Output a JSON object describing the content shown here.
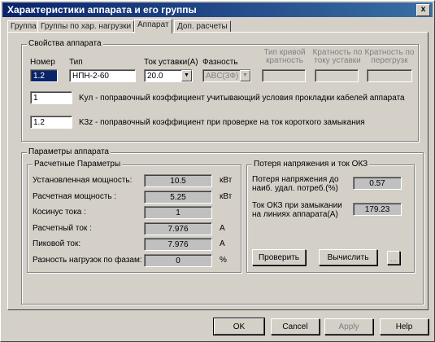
{
  "window": {
    "title": "Характеристики аппарата и его группы",
    "close_label": "x"
  },
  "tabs": [
    "Группа",
    "Группы по хар. нагрузки",
    "Аппарат",
    "Доп. расчеты"
  ],
  "device_props": {
    "legend": "Свойства аппарата",
    "number_label": "Номер",
    "number_value": "1.2",
    "type_label": "Тип",
    "type_value": "НПН-2-60",
    "current_label": "Ток уставки(А)",
    "current_value": "20.0",
    "phase_label": "Фазность",
    "phase_value": "ABC(3Ф)",
    "type_mult_label": "Тип кривой кратность",
    "mult_current_label": "Кратность по току уставки",
    "mult_overload_label": "Кратность по перегрузк",
    "kul_value": "1",
    "kul_label": "Kул - поправочный коэффициент учитывающий условия прокладки кабелей аппарата",
    "k3z_value": "1.2",
    "k3z_label": "K3z - поправочный коэффициент при проверке на ток короткого замыкания"
  },
  "device_params": {
    "legend": "Параметры аппарата",
    "calc": {
      "legend": "Расчетные Параметры",
      "rows": [
        {
          "label": "Установленная мощность:",
          "value": "10.5",
          "unit": "кВт"
        },
        {
          "label": "Расчетная мощность :",
          "value": "5.25",
          "unit": "кВт"
        },
        {
          "label": "Косинус тока :",
          "value": "1",
          "unit": ""
        },
        {
          "label": "Расчетный ток :",
          "value": "7.976",
          "unit": "A"
        },
        {
          "label": "Пиковой ток:",
          "value": "7.976",
          "unit": "A"
        },
        {
          "label": "Разность нагрузок по фазам:",
          "value": "0",
          "unit": "%"
        }
      ]
    },
    "loss": {
      "legend": "Потеря напряжения и ток ОКЗ",
      "voltage_loss_label": "Потеря напряжения до наиб. удал. потреб.(%)",
      "voltage_loss_value": "0.57",
      "okz_label": "Ток ОКЗ при замыкании на линиях аппарата(А)",
      "okz_value": "179.23",
      "check_button": "Проверить",
      "compute_button": "Вычислить",
      "extra_button": "..."
    }
  },
  "footer": {
    "ok": "OK",
    "cancel": "Cancel",
    "apply": "Apply",
    "help": "Help"
  },
  "colors": {
    "face": "#d4d0c8",
    "title_start": "#0a246a",
    "title_end": "#3a6ea5",
    "selection": "#0a246a"
  }
}
